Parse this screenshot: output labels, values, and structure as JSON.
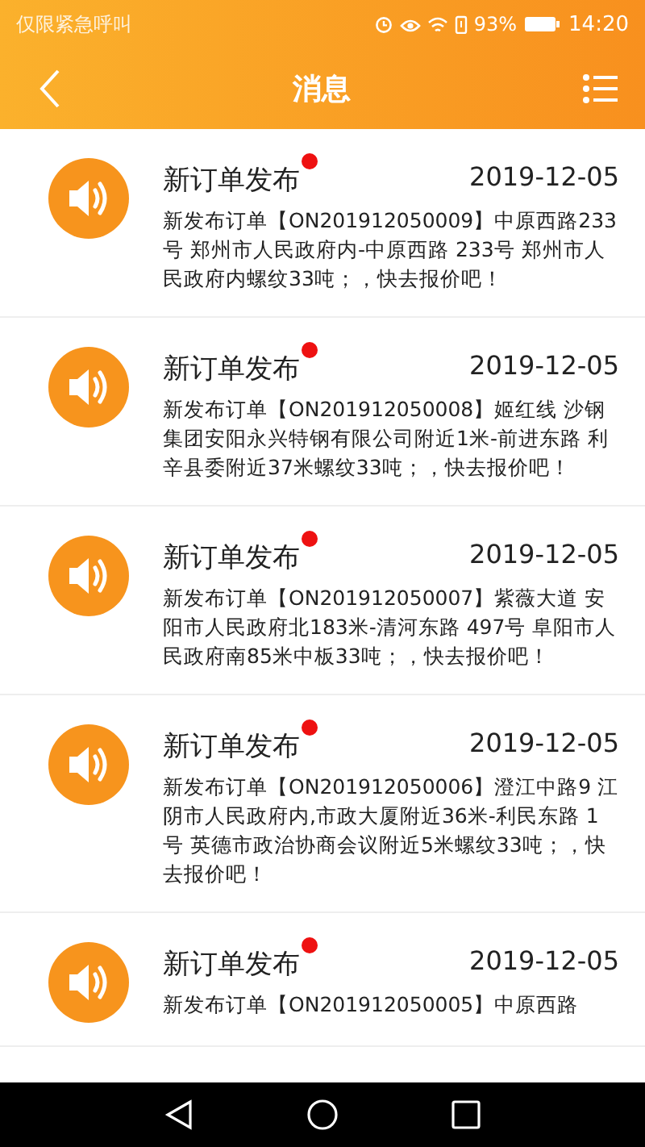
{
  "status_bar": {
    "carrier": "仅限紧急呼叫",
    "battery": "93%",
    "time": "14:20"
  },
  "header": {
    "title": "消息"
  },
  "messages": [
    {
      "title": "新订单发布",
      "unread": true,
      "date": "2019-12-05",
      "body": "新发布订单【ON201912050009】中原西路233号 郑州市人民政府内-中原西路 233号 郑州市人民政府内螺纹33吨；，快去报价吧！"
    },
    {
      "title": "新订单发布",
      "unread": true,
      "date": "2019-12-05",
      "body": "新发布订单【ON201912050008】姬红线  沙钢集团安阳永兴特钢有限公司附近1米-前进东路  利辛县委附近37米螺纹33吨；，快去报价吧！"
    },
    {
      "title": "新订单发布",
      "unread": true,
      "date": "2019-12-05",
      "body": "新发布订单【ON201912050007】紫薇大道 安阳市人民政府北183米-清河东路 497号 阜阳市人民政府南85米中板33吨；，快去报价吧！"
    },
    {
      "title": "新订单发布",
      "unread": true,
      "date": "2019-12-05",
      "body": "新发布订单【ON201912050006】澄江中路9 江阴市人民政府内,市政大厦附近36米-利民东路 1号 英德市政治协商会议附近5米螺纹33吨；，快去报价吧！"
    },
    {
      "title": "新订单发布",
      "unread": true,
      "date": "2019-12-05",
      "body": "新发布订单【ON201912050005】中原西路"
    }
  ]
}
